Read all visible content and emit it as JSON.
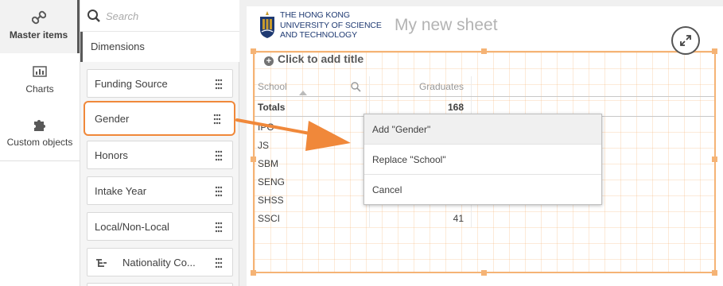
{
  "nav": {
    "items": [
      {
        "label": "Master items",
        "icon": "link-icon"
      },
      {
        "label": "Charts",
        "icon": "bar-chart-icon"
      },
      {
        "label": "Custom objects",
        "icon": "puzzle-icon"
      }
    ]
  },
  "panel": {
    "search_placeholder": "Search",
    "section_label": "Dimensions",
    "dimensions": [
      {
        "label": "Funding Source"
      },
      {
        "label": "Gender"
      },
      {
        "label": "Honors"
      },
      {
        "label": "Intake Year"
      },
      {
        "label": "Local/Non-Local"
      },
      {
        "label": "Nationality Co..."
      }
    ]
  },
  "sheet": {
    "logo_text": [
      "THE HONG KONG",
      "UNIVERSITY OF SCIENCE",
      "AND TECHNOLOGY"
    ],
    "title": "My new sheet",
    "add_title": "Click to add title"
  },
  "table": {
    "headers": [
      "School",
      "Graduates"
    ],
    "totals_label": "Totals",
    "totals_value": "168",
    "rows": [
      {
        "school": "IPO",
        "graduates": ""
      },
      {
        "school": "JS",
        "graduates": ""
      },
      {
        "school": "SBM",
        "graduates": ""
      },
      {
        "school": "SENG",
        "graduates": ""
      },
      {
        "school": "SHSS",
        "graduates": ""
      },
      {
        "school": "SSCI",
        "graduates": "41"
      }
    ]
  },
  "menu": {
    "items": [
      "Add \"Gender\"",
      "Replace \"School\"",
      "Cancel"
    ]
  },
  "colors": {
    "highlight": "#f0883a",
    "grid": "#f5b375",
    "brand": "#1f3a72"
  }
}
